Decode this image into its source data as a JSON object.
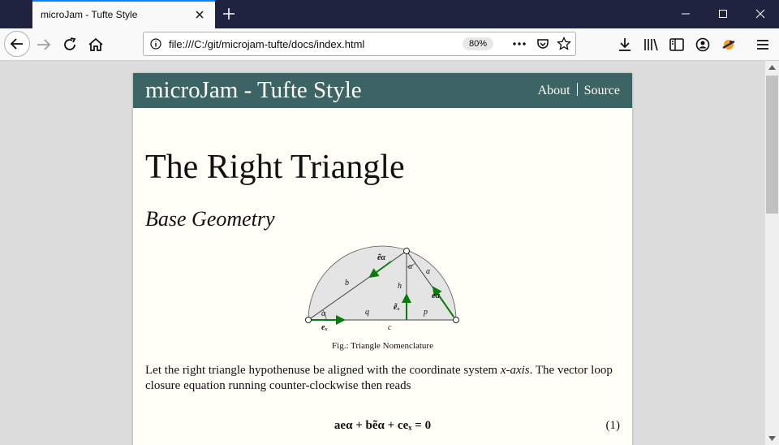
{
  "browser": {
    "tab_title": "microJam - Tufte Style",
    "url": "file:///C:/git/microjam-tufte/docs/index.html",
    "zoom": "80%"
  },
  "page": {
    "site_title": "microJam - Tufte Style",
    "nav": {
      "about": "About",
      "source": "Source"
    },
    "heading": "The Right Triangle",
    "subheading": "Base Geometry",
    "figure_caption": "Fig.: Triangle Nomenclature",
    "paragraph_before": "Let the right triangle hypothenuse be aligned with the coordinate system ",
    "paragraph_em": "x-axis",
    "paragraph_after": ". The vector loop closure equation running counter-clockwise then reads",
    "equation": "aeα + bẽα + ceₓ = 0",
    "equation_number": "(1)",
    "figure_labels": {
      "alpha": "α",
      "b": "b",
      "a": "a",
      "h": "h",
      "q": "q",
      "p": "p",
      "c": "c",
      "e_alpha_tilde": "ẽα",
      "e_alpha": "eα",
      "e_x_tilde": "ẽₓ",
      "e_x": "eₓ"
    }
  },
  "colors": {
    "header": "#3c6464",
    "page_bg": "#fffff8",
    "vector": "#0a7a0a"
  }
}
